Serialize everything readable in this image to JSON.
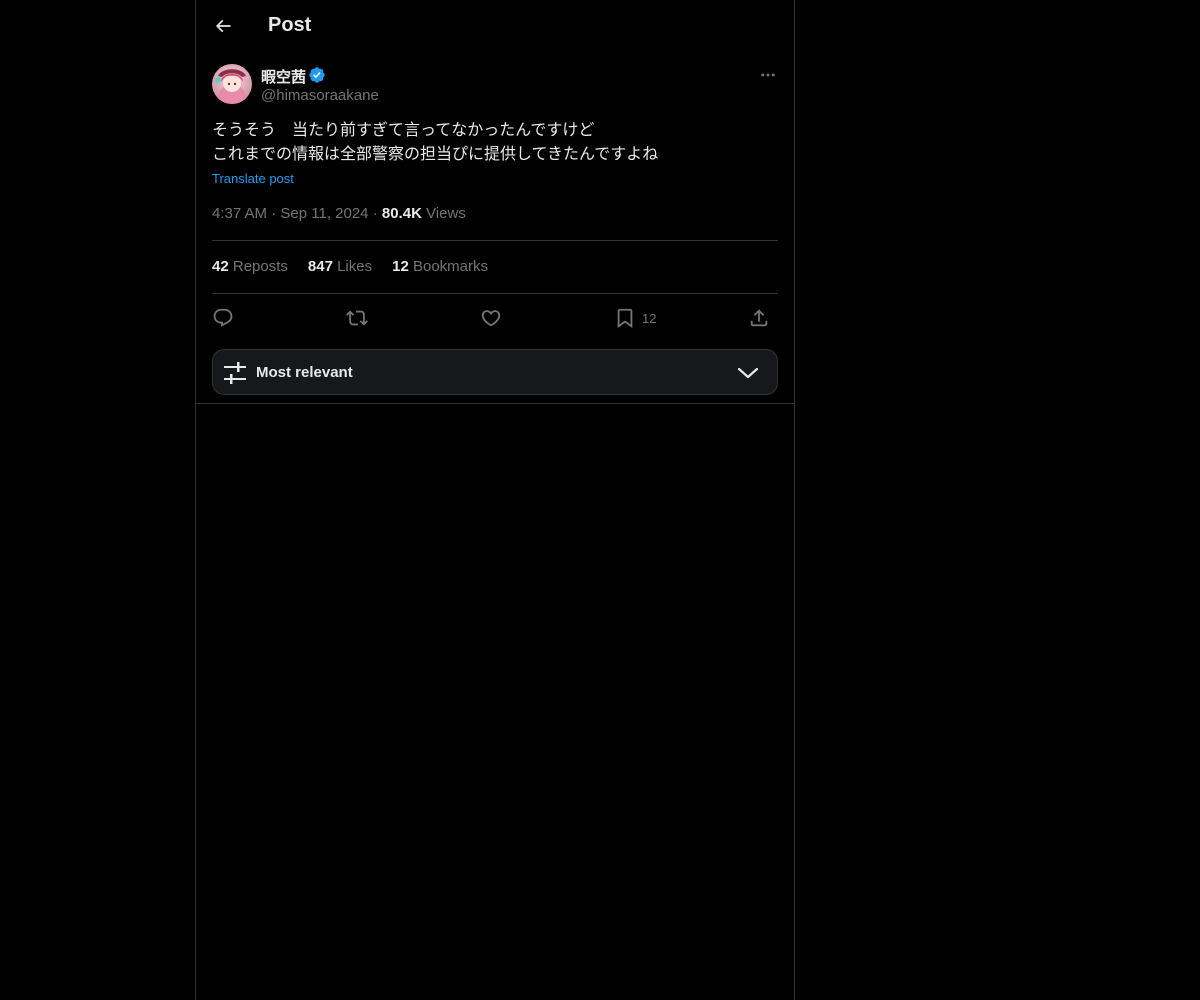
{
  "header": {
    "title": "Post"
  },
  "author": {
    "display_name": "暇空茜",
    "handle": "@himasoraakane",
    "verified": true
  },
  "post": {
    "lines": [
      "そうそう　当たり前すぎて言ってなかったんですけど",
      "これまでの情報は全部警察の担当ぴに提供してきたんですよね"
    ],
    "translate_label": "Translate post",
    "time": "4:37 AM",
    "date": "Sep 11, 2024",
    "views_count": "80.4K",
    "views_label": "Views"
  },
  "stats": {
    "reposts": {
      "count": "42",
      "label": "Reposts"
    },
    "likes": {
      "count": "847",
      "label": "Likes"
    },
    "bookmarks": {
      "count": "12",
      "label": "Bookmarks"
    }
  },
  "actions": {
    "bookmark_count": "12"
  },
  "sort": {
    "label": "Most relevant"
  },
  "colors": {
    "background": "#000000",
    "text": "#e7e9ea",
    "muted": "#71767b",
    "accent": "#1d9bf0",
    "border": "#2f3336"
  },
  "icons": [
    "back-arrow-icon",
    "verified-badge-icon",
    "more-icon",
    "reply-icon",
    "repost-icon",
    "like-icon",
    "bookmark-icon",
    "share-icon",
    "sort-sliders-icon",
    "chevron-down-icon"
  ]
}
